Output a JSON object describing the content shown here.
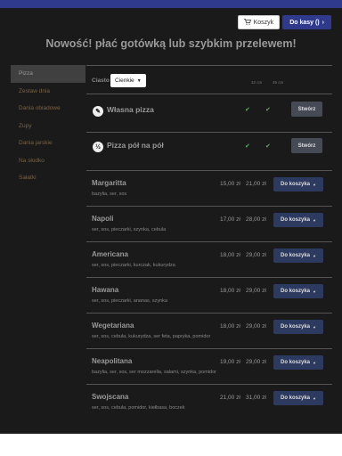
{
  "header": {
    "cart_icon": "cart-icon",
    "cart_label": "Koszyk",
    "checkout_label": "Do kasy ()",
    "checkout_arrow": "›"
  },
  "headline": "Nowość! płać gotówką lub szybkim przelewem!",
  "sidebar": {
    "items": [
      {
        "label": "Pizza",
        "active": true
      },
      {
        "label": "Zestaw dnia"
      },
      {
        "label": "Dania obiadowe"
      },
      {
        "label": "Zupy"
      },
      {
        "label": "Dania jarskie"
      },
      {
        "label": "Na słodko"
      },
      {
        "label": "Sałatki"
      }
    ]
  },
  "table_header": {
    "dough_label": "Ciasto",
    "dough_value": "Cienkie",
    "size_1": "32 cm",
    "size_2": "45 cm"
  },
  "custom": [
    {
      "icon": "pizza-cutter-icon",
      "icon_text": "✎",
      "title": "Własna pizza",
      "check_1": "✔",
      "check_2": "✔",
      "button": "Stwórz"
    },
    {
      "icon": "half-half-icon",
      "icon_text": "½",
      "title": "Pizza pół na pół",
      "check_1": "✔",
      "check_2": "✔",
      "button": "Stwórz"
    }
  ],
  "add_button": "Do koszyka",
  "pizzas": [
    {
      "name": "Margaritta",
      "desc": "bazylia, ser, sos",
      "price_1": "15,00 zł",
      "price_2": "21,00 zł"
    },
    {
      "name": "Napoli",
      "desc": "ser, sos, pieczarki, szynka, cebula",
      "price_1": "17,00 zł",
      "price_2": "28,00 zł"
    },
    {
      "name": "Americana",
      "desc": "ser, sos, pieczarki, kurczak, kukurydza",
      "price_1": "18,00 zł",
      "price_2": "29,00 zł"
    },
    {
      "name": "Hawana",
      "desc": "ser, sos, pieczarki, ananas, szynka",
      "price_1": "18,00 zł",
      "price_2": "29,00 zł"
    },
    {
      "name": "Wegetariana",
      "desc": "ser, sos, cebula, kukurydza, ser feta, papryka, pomidor",
      "price_1": "18,00 zł",
      "price_2": "29,00 zł"
    },
    {
      "name": "Neapolitana",
      "desc": "bazylia, ser, sos, ser mozzarella, salami, szynka, pomidor",
      "price_1": "19,00 zł",
      "price_2": "29,00 zł"
    },
    {
      "name": "Swojscana",
      "desc": "ser, sos, cebula, pomidor, kiełbasa, boczek",
      "price_1": "21,00 zł",
      "price_2": "31,00 zł"
    }
  ],
  "colors": {
    "navbar": "#2f3a8c",
    "add_button": "#2c3a60",
    "check": "#5fae5f"
  }
}
